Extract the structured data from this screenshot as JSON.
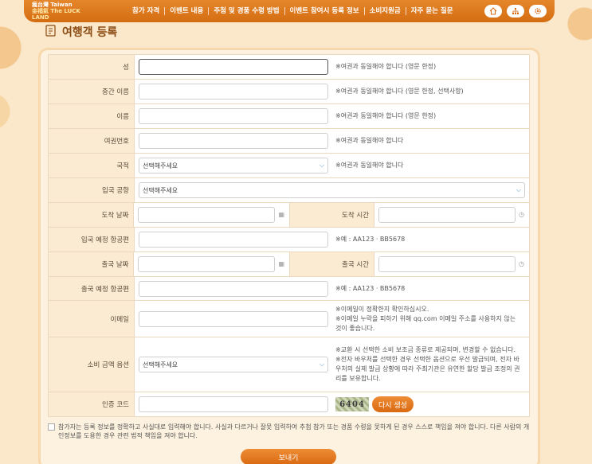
{
  "header": {
    "logo_line1": "瘋台灣 Taiwan",
    "logo_line2": "金福氣 The LUCK LAND",
    "nav": [
      "참가 자격",
      "이벤트 내용",
      "주첨 및 경품 수령 방법",
      "이벤트 참여시 등록 정보",
      "소비지원금",
      "자주 묻는 질문"
    ],
    "icons": [
      "home-icon",
      "sitemap-icon",
      "gear-icon"
    ]
  },
  "page": {
    "title": "여행객 등록"
  },
  "form": {
    "surname_label": "성",
    "surname_note": "※여권과 동일해야 합니다 (영문 한정)",
    "middle_label": "중간 이름",
    "middle_note": "※여권과 동일해야 합니다 (영문 한정, 선택사항)",
    "given_label": "이름",
    "given_note": "※여권과 동일해야 합니다 (영문 한정)",
    "passport_label": "여권번호",
    "passport_note": "※여권과 동일해야 합니다",
    "nationality_label": "국적",
    "nationality_value": "선택해주세요",
    "nationality_note": "※여권과 동일해야 합니다",
    "airport_label": "입국 공항",
    "airport_value": "선택해주세요",
    "arrival_date_label": "도착 날짜",
    "arrival_time_label": "도착 시간",
    "arrival_flight_label": "입국 예정 항공편",
    "arrival_flight_note": "※예 : AA123 · BB5678",
    "departure_date_label": "출국 날짜",
    "departure_time_label": "출국 시간",
    "departure_flight_label": "출국 예정 항공편",
    "departure_flight_note": "※예 : AA123 · BB5678",
    "email_label": "이메일",
    "email_note_1": "※이메일이 정확한지 확인하십시오.",
    "email_note_2": "※이메일 누락을 피하기 위해 qq.com 이메일 주소를 사용하지 않는 것이 좋습니다.",
    "amount_label": "소비 금액 옵션",
    "amount_value": "선택해주세요",
    "amount_note_1": "※교환 시 선택한 소비 보조금 종류로 제공되며, 변경할 수 없습니다.",
    "amount_note_2": "※전자 바우처를 선택한 경우 선택한 옵션으로 우선 발급되며, 전자 바우처의 실제 발급 상황에 따라 주최기관은 유연한 할당 발급 조정의 권리를 보유합니다.",
    "captcha_label": "인증 코드",
    "captcha_image_text": "6404",
    "regen_label": "다시 생성"
  },
  "agreement": "참가자는 등록 정보를 정확하고 사실대로 입력해야 합니다. 사실과 다르거나 잘못 입력하여 추첨 참가 또는 경품 수령을 못하게 된 경우 스스로 책임을 져야 합니다. 다른 사람의 개인정보를 도용한 경우 관련 법적 책임을 져야 합니다.",
  "submit_label": "보내기",
  "colors": {
    "brand_orange": "#d96a12",
    "label_bg": "#fbebd2",
    "page_bg": "#fbe7c9"
  }
}
